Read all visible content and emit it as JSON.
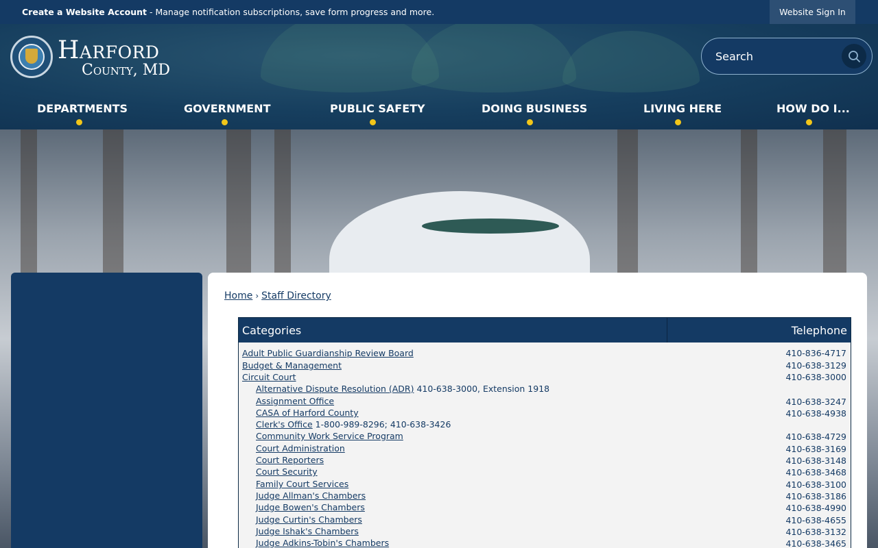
{
  "topbar": {
    "account_bold": "Create a Website Account",
    "account_rest": " - Manage notification subscriptions, save form progress and more.",
    "signin": "Website Sign In"
  },
  "header": {
    "logo_line1": "Harford",
    "logo_line2": "County, MD",
    "search_placeholder": "Search",
    "search_icon": "search-icon"
  },
  "nav": [
    {
      "label": "DEPARTMENTS"
    },
    {
      "label": "GOVERNMENT"
    },
    {
      "label": "PUBLIC SAFETY"
    },
    {
      "label": "DOING BUSINESS"
    },
    {
      "label": "LIVING HERE"
    },
    {
      "label": "HOW DO I..."
    }
  ],
  "breadcrumb": {
    "home": "Home",
    "separator": "›",
    "current": "Staff Directory"
  },
  "directory": {
    "header_categories": "Categories",
    "header_telephone": "Telephone",
    "rows": [
      {
        "name": "Adult Public Guardianship Review Board",
        "extra": "",
        "tel": "410-836-4717",
        "indent": false
      },
      {
        "name": "Budget & Management",
        "extra": "",
        "tel": "410-638-3129",
        "indent": false
      },
      {
        "name": "Circuit Court",
        "extra": "",
        "tel": "410-638-3000",
        "indent": false
      },
      {
        "name": "Alternative Dispute Resolution (ADR)",
        "extra": " 410-638-3000, Extension 1918",
        "tel": "",
        "indent": true
      },
      {
        "name": "Assignment Office",
        "extra": "",
        "tel": "410-638-3247",
        "indent": true
      },
      {
        "name": "CASA of Harford County",
        "extra": "",
        "tel": "410-638-4938",
        "indent": true
      },
      {
        "name": "Clerk's Office",
        "extra": " 1-800-989-8296; 410-638-3426",
        "tel": "",
        "indent": true
      },
      {
        "name": "Community Work Service Program",
        "extra": "",
        "tel": "410-638-4729",
        "indent": true
      },
      {
        "name": "Court Administration",
        "extra": "",
        "tel": "410-638-3169",
        "indent": true
      },
      {
        "name": "Court Reporters",
        "extra": "",
        "tel": "410-638-3148",
        "indent": true
      },
      {
        "name": "Court Security",
        "extra": "",
        "tel": "410-638-3468",
        "indent": true
      },
      {
        "name": "Family Court Services",
        "extra": "",
        "tel": "410-638-3100",
        "indent": true
      },
      {
        "name": "Judge Allman's Chambers",
        "extra": "",
        "tel": "410-638-3186",
        "indent": true
      },
      {
        "name": "Judge Bowen's Chambers",
        "extra": "",
        "tel": "410-638-4990",
        "indent": true
      },
      {
        "name": "Judge Curtin's Chambers",
        "extra": "",
        "tel": "410-638-4655",
        "indent": true
      },
      {
        "name": "Judge Ishak's Chambers",
        "extra": "",
        "tel": "410-638-3132",
        "indent": true
      },
      {
        "name": "Judge Adkins-Tobin's Chambers",
        "extra": "",
        "tel": "410-638-3465",
        "indent": true
      }
    ]
  },
  "colors": {
    "navy": "#143a64",
    "accent_dot": "#f2c619",
    "table_bg": "#f3f3f3"
  }
}
